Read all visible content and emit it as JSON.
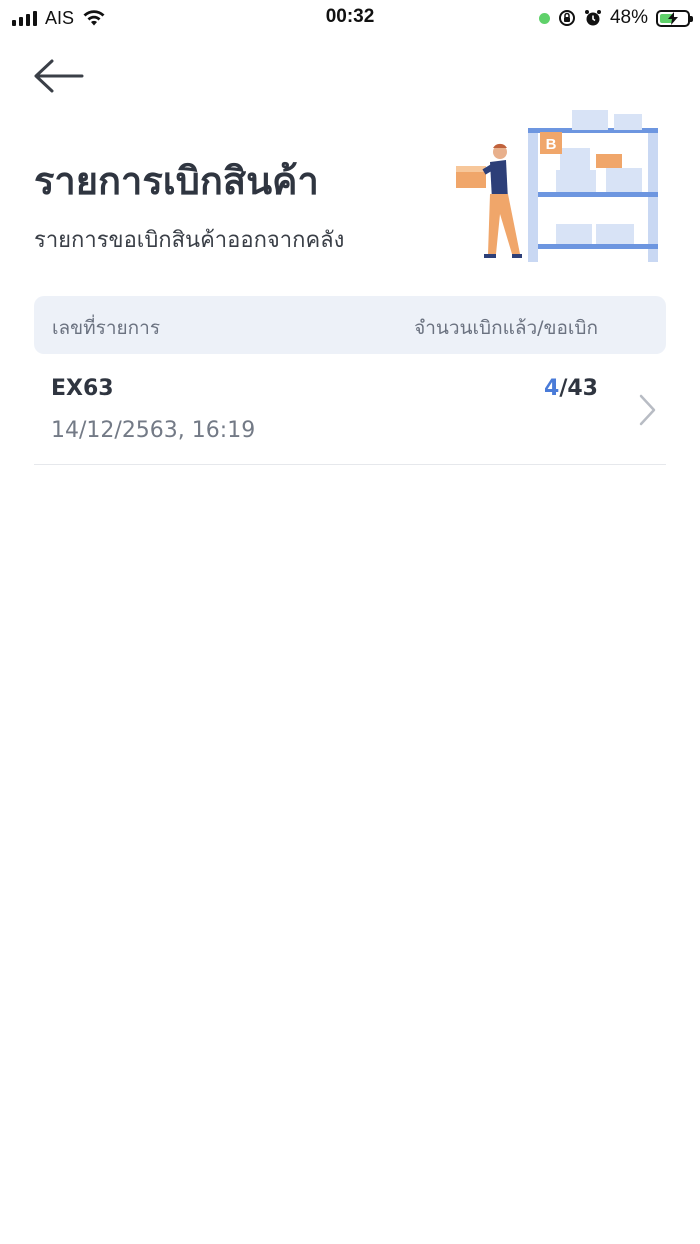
{
  "status_bar": {
    "carrier": "AIS",
    "time": "00:32",
    "battery_percent": "48%",
    "battery_level": 0.48,
    "icons": [
      "signal-icon",
      "wifi-icon",
      "green-dot-indicator",
      "rotation-lock-icon",
      "alarm-icon",
      "battery-charging-icon"
    ]
  },
  "header": {
    "back_icon": "arrow-left-icon",
    "title": "รายการเบิกสินค้า",
    "subtitle": "รายการขอเบิกสินค้าออกจากคลัง"
  },
  "table": {
    "columns": [
      "เลขที่รายการ",
      "จำนวนเบิกแล้ว/ขอเบิก"
    ],
    "rows": [
      {
        "id": "EX63",
        "datetime": "14/12/2563, 16:19",
        "withdrawn": "4",
        "separator": "/",
        "requested": "43"
      }
    ]
  },
  "colors": {
    "accent": "#4a7bd8",
    "header_bg": "#edf1f8",
    "text_primary": "#2f3540",
    "text_secondary": "#737a86"
  }
}
